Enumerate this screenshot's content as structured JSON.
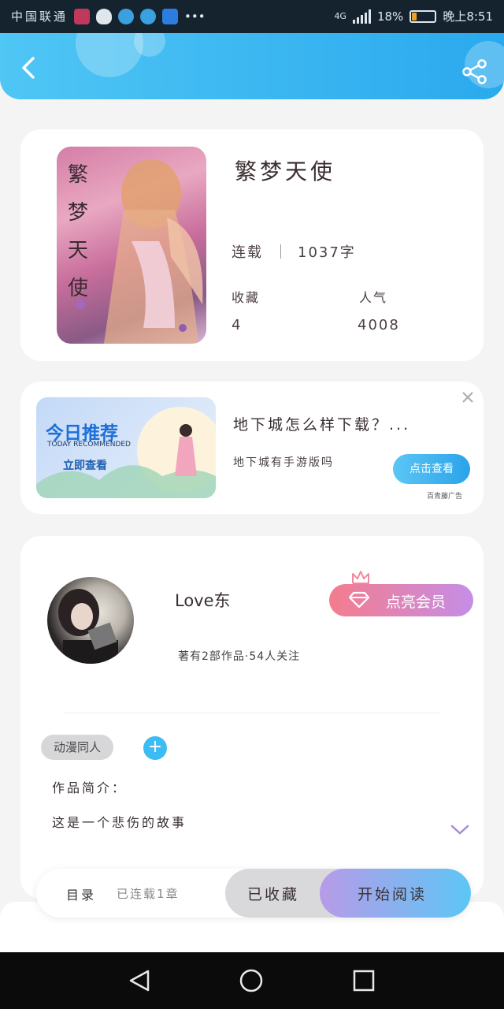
{
  "status_bar": {
    "left_text": "中国联通",
    "time": "晚上8:51",
    "battery": "18%",
    "battery_level": 0.18,
    "network": "4G"
  },
  "header": {
    "back_icon": "chevron-left-icon",
    "share_icon": "share-icon"
  },
  "book": {
    "title": "繁梦天使",
    "cover_text": "繁梦天使",
    "status_label": "连载",
    "word_count": "1037字",
    "favorites_label": "收藏",
    "favorites_value": "4",
    "popularity_label": "人气",
    "popularity_value": "4008"
  },
  "ad": {
    "image_title": "今日推荐",
    "image_subtitle": "TODAY RECOMMENDED",
    "image_button": "立即查看",
    "headline": "地下城怎么样下载？...",
    "description": "地下城有手游版吗",
    "cta": "点击查看",
    "source": "百青藤广告",
    "close_icon": "close-icon"
  },
  "author": {
    "name": "Love东",
    "stats": "著有2部作品·54人关注",
    "vip_button": "点亮会员",
    "crown_icon": "crown-icon",
    "diamond_icon": "diamond-icon"
  },
  "tags": {
    "items": [
      "动漫同人"
    ],
    "add_label": "+"
  },
  "intro": {
    "label": "作品简介：",
    "text": "这是一个悲伤的故事",
    "expand_icon": "chevron-down-icon"
  },
  "bottom_bar": {
    "catalog_label": "目录",
    "catalog_status": "已连载1章",
    "collected_label": "已收藏",
    "read_label": "开始阅读"
  },
  "nav": {
    "back_icon": "triangle-back-icon",
    "home_icon": "circle-home-icon",
    "recent_icon": "square-recent-icon"
  },
  "colors": {
    "header_start": "#4fc6f4",
    "header_end": "#2aa9ee",
    "vip_start": "#f47c8e",
    "vip_end": "#c58ee6",
    "read_start": "#b79be8",
    "read_end": "#5cc6f5",
    "accent": "#3cbcf3"
  }
}
